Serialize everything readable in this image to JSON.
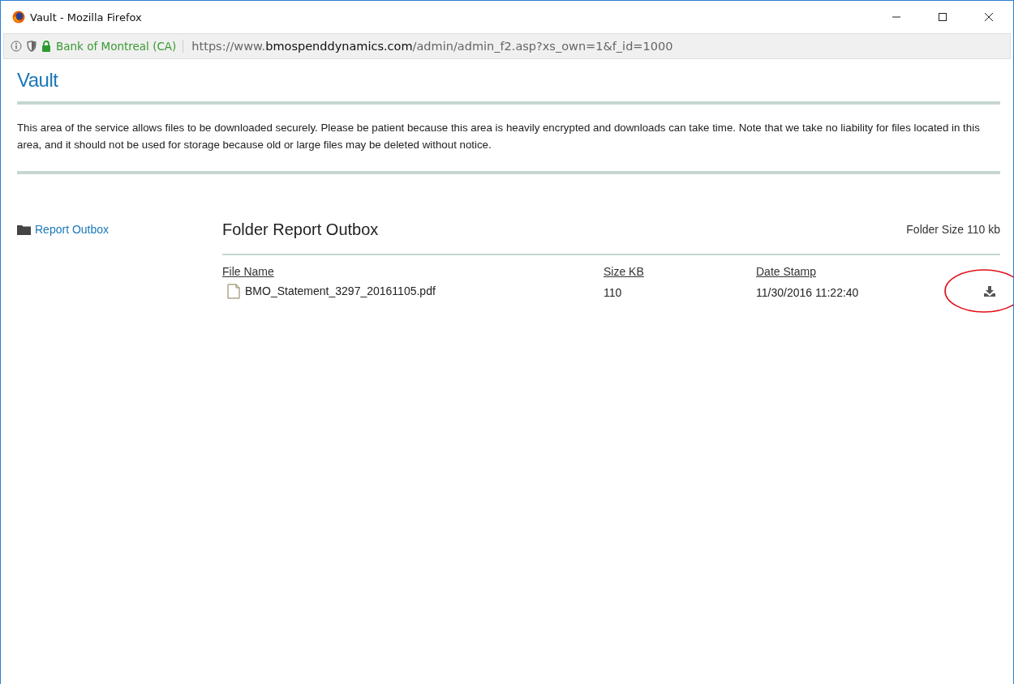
{
  "window": {
    "title": "Vault - Mozilla Firefox"
  },
  "address_bar": {
    "site_identity": "Bank of Montreal (CA)",
    "url_prefix": "https://www.",
    "url_domain": "bmospenddynamics.com",
    "url_path": "/admin/admin_f2.asp?xs_own=1&f_id=1000"
  },
  "page": {
    "title": "Vault",
    "notice": "This area of the service allows files to be downloaded securely. Please be patient because this area is heavily encrypted and downloads can take time. Note that we take no liability for files located in this area, and it should not be used for storage because old or large files may be deleted without notice."
  },
  "sidebar": {
    "items": [
      {
        "label": "Report Outbox"
      }
    ]
  },
  "folder": {
    "title": "Folder Report Outbox",
    "size": "Folder Size 110 kb",
    "columns": [
      "File Name",
      "Size KB",
      "Date Stamp"
    ],
    "rows": [
      {
        "name": "BMO_Statement_3297_20161105.pdf",
        "size": "110",
        "date": "11/30/2016 11:22:40",
        "highlighted": true
      }
    ]
  }
}
